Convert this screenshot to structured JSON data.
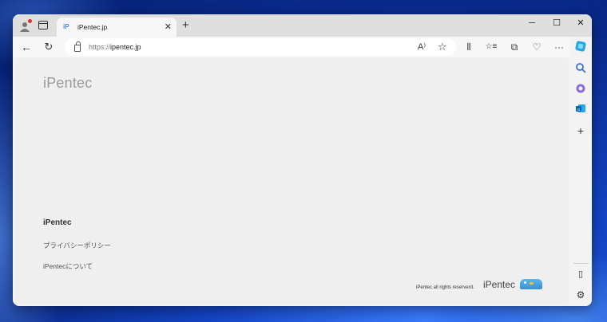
{
  "tab": {
    "title": "iPentec.jp",
    "favicon": "iP"
  },
  "window_controls": {
    "minimize": "─",
    "maximize": "☐",
    "close": "✕"
  },
  "toolbar": {
    "back": "←",
    "refresh": "↻",
    "url_scheme": "https://",
    "url_host": "ipentec.jp",
    "read_aloud": "A⁾",
    "favorite": "☆",
    "split": "⫴",
    "favorites": "☆≡",
    "collections": "⧉",
    "health": "♡",
    "more": "···"
  },
  "page": {
    "logo": "iPentec",
    "footer_title": "iPentec",
    "links": [
      "プライバシーポリシー",
      "iPentecについて"
    ],
    "copyright": "iPentec all rights reserverd.",
    "footer_logo": "iPentec"
  },
  "sidebar": {
    "copilot": "◆",
    "search": "⌕",
    "add": "+",
    "panel": "▯",
    "settings": "⚙"
  },
  "colors": {
    "accent": "#3c8ce6",
    "copilot": "#2aa3e8"
  }
}
